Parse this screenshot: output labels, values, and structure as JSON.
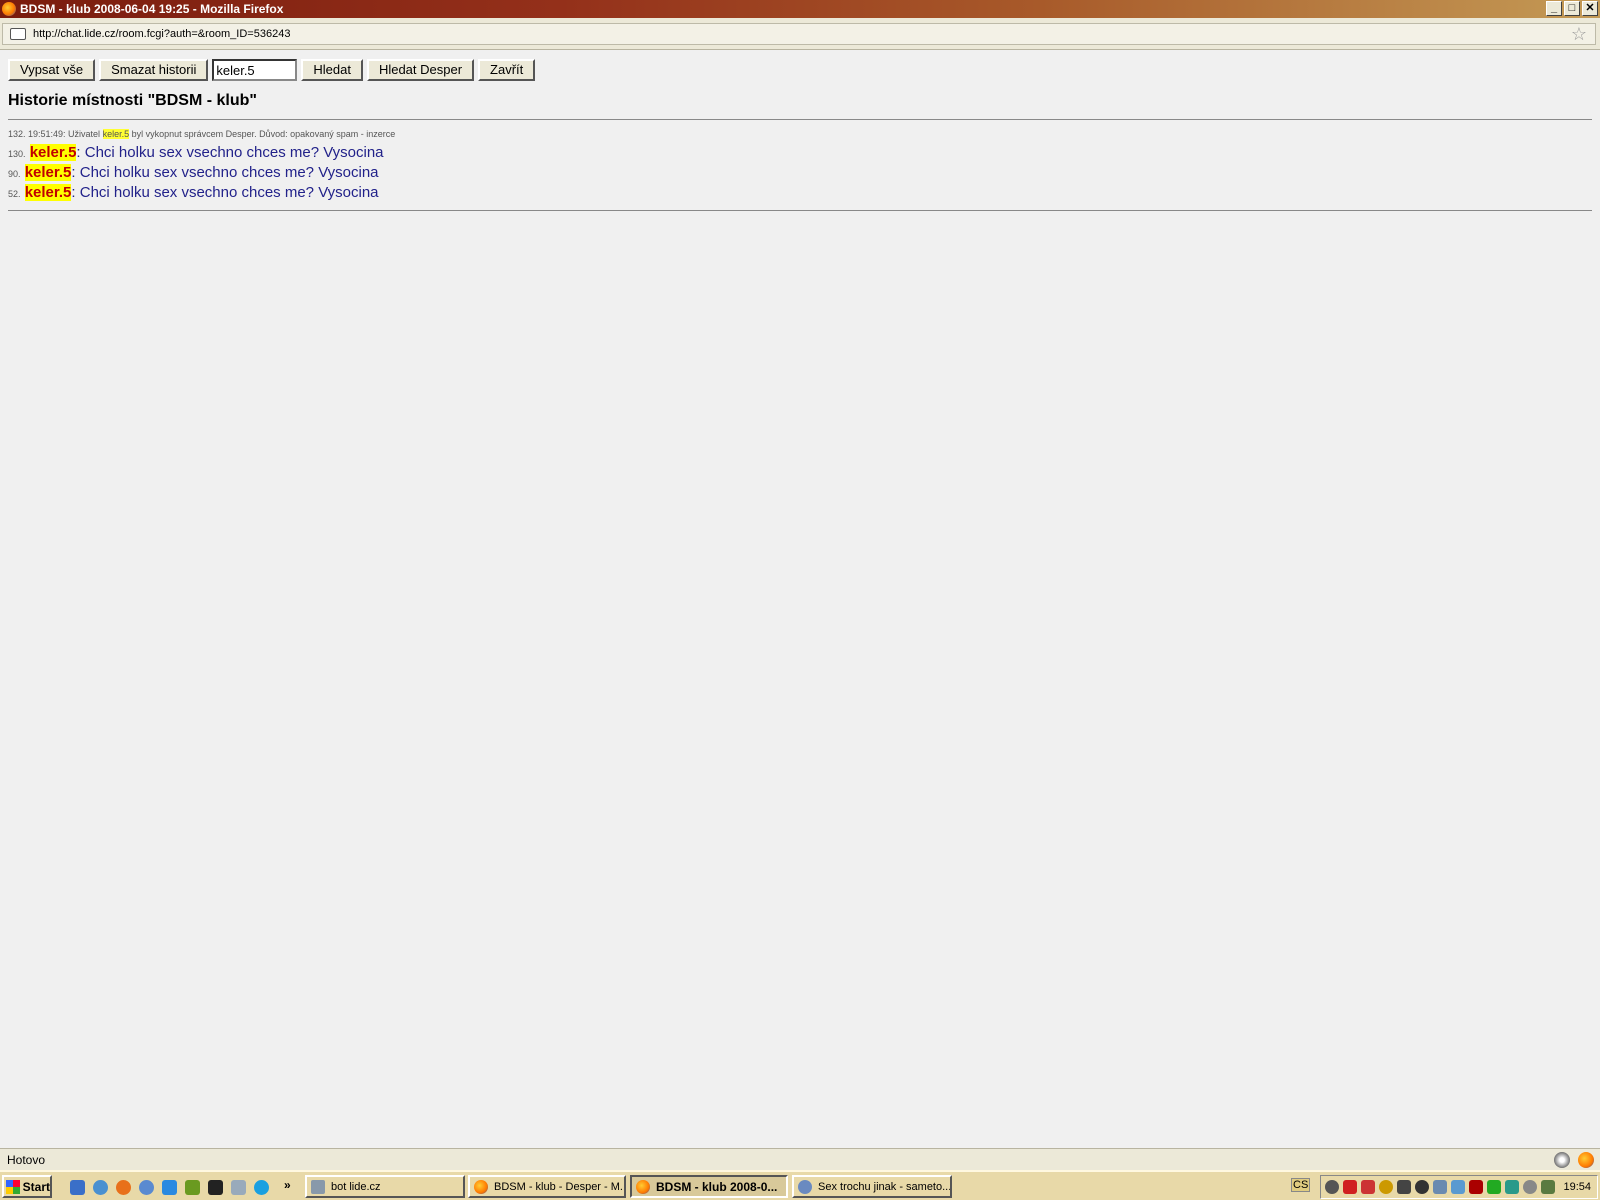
{
  "window": {
    "title": "BDSM - klub 2008-06-04 19:25 - Mozilla Firefox",
    "buttons": [
      "_",
      "□",
      "✕"
    ]
  },
  "urlbar": {
    "url": "http://chat.lide.cz/room.fcgi?auth=&room_ID=536243"
  },
  "toolbar": {
    "vypsat_label": "Vypsat vše",
    "smazat_label": "Smazat historii",
    "search_value": "keler.5",
    "hledat_label": "Hledat",
    "hledat_desper_label": "Hledat Desper",
    "zavrit_label": "Zavřít"
  },
  "heading": "Historie místnosti \"BDSM - klub\"",
  "system_message": {
    "prefix": "132. 19:51:49: Uživatel ",
    "user": "keler.5",
    "suffix": " byl vykopnut správcem Desper. Důvod: opakovaný spam - inzerce"
  },
  "messages": [
    {
      "num": "130.",
      "nick": "keler.5",
      "sep": ":",
      "text": " Chci holku sex vsechno chces me? Vysocina"
    },
    {
      "num": "90.",
      "nick": "keler.5",
      "sep": ":",
      "text": " Chci holku sex vsechno chces me? Vysocina"
    },
    {
      "num": "52.",
      "nick": "keler.5",
      "sep": ":",
      "text": " Chci holku sex vsechno chces me? Vysocina"
    }
  ],
  "status": {
    "text": "Hotovo"
  },
  "taskbar": {
    "start_label": "Start",
    "chevron": "»",
    "tasks": [
      "bot lide.cz",
      "BDSM - klub - Desper - M...",
      "BDSM - klub 2008-0...",
      "Sex trochu jinak - sameto..."
    ],
    "language": "CS",
    "clock": "19:54"
  },
  "colors": {
    "nick_highlight": "#ffff00",
    "nick_text": "#c00000",
    "message_text": "#22228a"
  }
}
